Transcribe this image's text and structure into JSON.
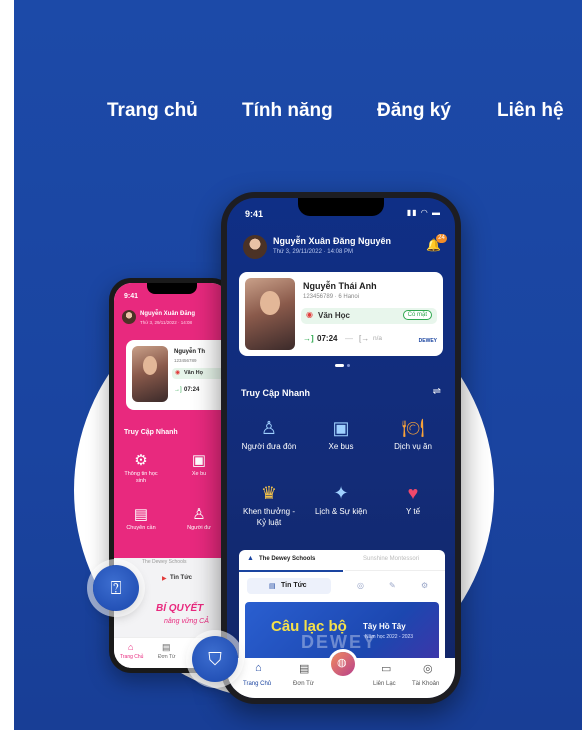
{
  "nav": {
    "home": "Trang chủ",
    "features": "Tính năng",
    "register": "Đăng ký",
    "contact": "Liên hệ"
  },
  "front": {
    "status_time": "9:41",
    "user_name": "Nguyễn Xuân Đăng Nguyên",
    "user_date": "Thứ 3, 29/11/2022 · 14:08 PM",
    "notif_count": "24",
    "student_name": "Nguyễn Thái Anh",
    "student_meta": "123456789 · 6 Hanoi",
    "subject": "Văn Học",
    "attendance_badge": "Có mặt",
    "checkin_time": "07:24",
    "checkout_time": "n/a",
    "school_logo": "DEWEY",
    "quick_access_title": "Truy Cập Nhanh",
    "features": [
      {
        "label": "Người đưa đón",
        "icon": "pickup-person-icon"
      },
      {
        "label": "Xe bus",
        "icon": "bus-icon"
      },
      {
        "label": "Dịch vụ ăn",
        "icon": "dining-icon"
      },
      {
        "label": "Khen thưởng - Kỷ luật",
        "icon": "award-icon"
      },
      {
        "label": "Lịch & Sự kiện",
        "icon": "calendar-icon"
      },
      {
        "label": "Y tế",
        "icon": "health-icon"
      }
    ],
    "school_tabs": [
      "The Dewey Schools",
      "Sunshine Montessori"
    ],
    "news_tab": "Tin Tức",
    "banner_title": "Câu lạc bộ",
    "banner_logo": "DEWEY",
    "banner_sub": "Tây Hồ Tây",
    "banner_year": "Năm học 2022 - 2023",
    "bottom_nav": [
      "Trang Chủ",
      "Đơn Từ",
      "Liên Lạc",
      "Tài Khoản"
    ]
  },
  "back": {
    "status_time": "9:41",
    "user_name": "Nguyễn Xuân Đăng",
    "user_date": "Thứ 3, 29/11/2022 · 14:08",
    "student_name": "Nguyễn Th",
    "student_meta": "123456789",
    "subject": "Văn Họ",
    "checkin_time": "07:24",
    "quick_access_title": "Truy Cập Nhanh",
    "features": [
      {
        "label": "Thông tin học sinh",
        "icon": "student-info-icon"
      },
      {
        "label": "Xe bu",
        "icon": "bus-icon"
      },
      {
        "label": "Chuyên cần",
        "icon": "attendance-icon"
      },
      {
        "label": "Người đư",
        "icon": "pickup-person-icon"
      }
    ],
    "school_tab": "The Dewey Schools",
    "news_tab": "Tin Tức",
    "promo_title": "BÍ QUYẾT",
    "promo_sub": "nâng vững CẢ",
    "bottom_nav": [
      "Trang Chủ",
      "Đơn Từ"
    ]
  },
  "colors": {
    "banner": "#1a44a0",
    "pink": "#e8297e",
    "green": "#2fa84f",
    "accent_orange": "#f28c28"
  }
}
